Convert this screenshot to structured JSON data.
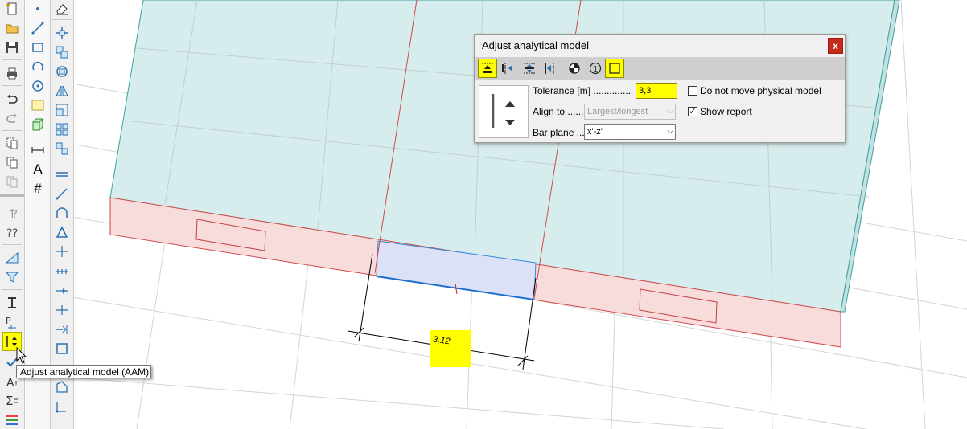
{
  "dialog": {
    "title": "Adjust analytical model",
    "close_label": "x",
    "tolerance_label": "Tolerance [m] ..............",
    "tolerance_value": "3,3",
    "align_to_label": "Align to ......",
    "align_to_value": "Largest/longest",
    "bar_plane_label": "Bar plane ...",
    "bar_plane_value": "x'-z'",
    "do_not_move_label": "Do not move physical model",
    "do_not_move_checked": false,
    "show_report_label": "Show report",
    "show_report_checked": true,
    "highlight_color": "#ffff00"
  },
  "tooltip": {
    "text": "Adjust analytical model (AAM)"
  },
  "toolbar": {
    "text_tool_label": "A",
    "hash_tool_label": "#"
  },
  "viewport": {
    "dimension_value": "3,12",
    "slab_fill": "#d7ecec",
    "beam_fill": "#f8dcdc",
    "selected_fill": "#dde1f7",
    "beam_line": "#d24a4a",
    "grid_color": "#cfcfcf"
  }
}
